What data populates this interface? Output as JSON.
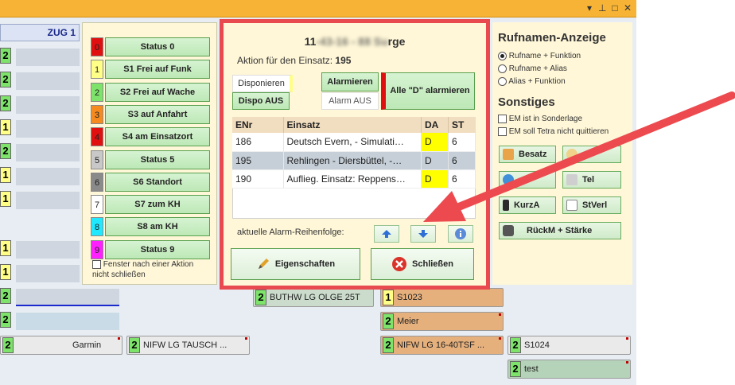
{
  "left": {
    "zug_header": "ZUG 1"
  },
  "status": {
    "items": [
      {
        "num": "0",
        "label": "Status 0",
        "color": "#e01010"
      },
      {
        "num": "1",
        "label": "S1 Frei auf Funk",
        "color": "#ffff88"
      },
      {
        "num": "2",
        "label": "S2 Frei auf Wache",
        "color": "#7de36a"
      },
      {
        "num": "3",
        "label": "S3 auf Anfahrt",
        "color": "#f58a1f"
      },
      {
        "num": "4",
        "label": "S4 am Einsatzort",
        "color": "#e01010"
      },
      {
        "num": "5",
        "label": "Status 5",
        "color": "#c8c8c8"
      },
      {
        "num": "6",
        "label": "S6 Standort",
        "color": "#8a8a8a"
      },
      {
        "num": "7",
        "label": "S7 zum KH",
        "color": "#ffffff"
      },
      {
        "num": "8",
        "label": "S8 am KH",
        "color": "#20e8ff"
      },
      {
        "num": "9",
        "label": "Status 9",
        "color": "#ff20ff"
      }
    ],
    "keep_window": "Fenster nach einer Aktion nicht schließen"
  },
  "dialog": {
    "title_left": "11",
    "title_right": "rge",
    "aktion_label": "Aktion für den Einsatz:",
    "aktion_num": "195",
    "disponieren": "Disponieren",
    "dispo_aus": "Dispo AUS",
    "alarmieren": "Alarmieren",
    "alarm_aus": "Alarm AUS",
    "alle_d": "Alle \"D\" alarmieren",
    "table": {
      "headers": [
        "ENr",
        "Einsatz",
        "DA",
        "ST"
      ],
      "rows": [
        {
          "enr": "186",
          "einsatz": "Deutsch Evern, - Simulati…",
          "da": "D",
          "st": "6"
        },
        {
          "enr": "195",
          "einsatz": "Rehlingen - Diersbüttel, -…",
          "da": "D",
          "st": "6"
        },
        {
          "enr": "190",
          "einsatz": "Auflieg. Einsatz: Reppens…",
          "da": "D",
          "st": "6"
        }
      ]
    },
    "reihenfolge": "aktuelle Alarm-Reihenfolge:",
    "eigenschaften": "Eigenschaften",
    "schliessen": "Schließen"
  },
  "right": {
    "rufnamen_title": "Rufnamen-Anzeige",
    "options": [
      "Rufname + Funktion",
      "Rufname + Alias",
      "Alias + Funktion"
    ],
    "sonstiges_title": "Sonstiges",
    "checks": [
      "EM ist in Sonderlage",
      "EM soll Tetra nicht quittieren"
    ],
    "buttons": {
      "besatz": "Besatz",
      "tel": "Tel",
      "kurza": "KurzA",
      "stverl": "StVerl",
      "rueckm": "RückM + Stärke"
    }
  },
  "units": {
    "garmin": "Garmin",
    "nifw_tausch": "NIFW LG   TAUSCH ...",
    "meier": "Meier",
    "nifw_16": "NIFW LG 16-40TSF ...",
    "s1024": "S1024",
    "test": "test",
    "s1023": "S1023",
    "buthw": "BUTHW LG OLGE 25T"
  },
  "colors": {
    "titlebar": "#f6b335",
    "dialog_border": "#e84a4f",
    "arrow": "#ec4a4f",
    "status_green": "#7de36a",
    "status_yellow": "#ffff88"
  }
}
